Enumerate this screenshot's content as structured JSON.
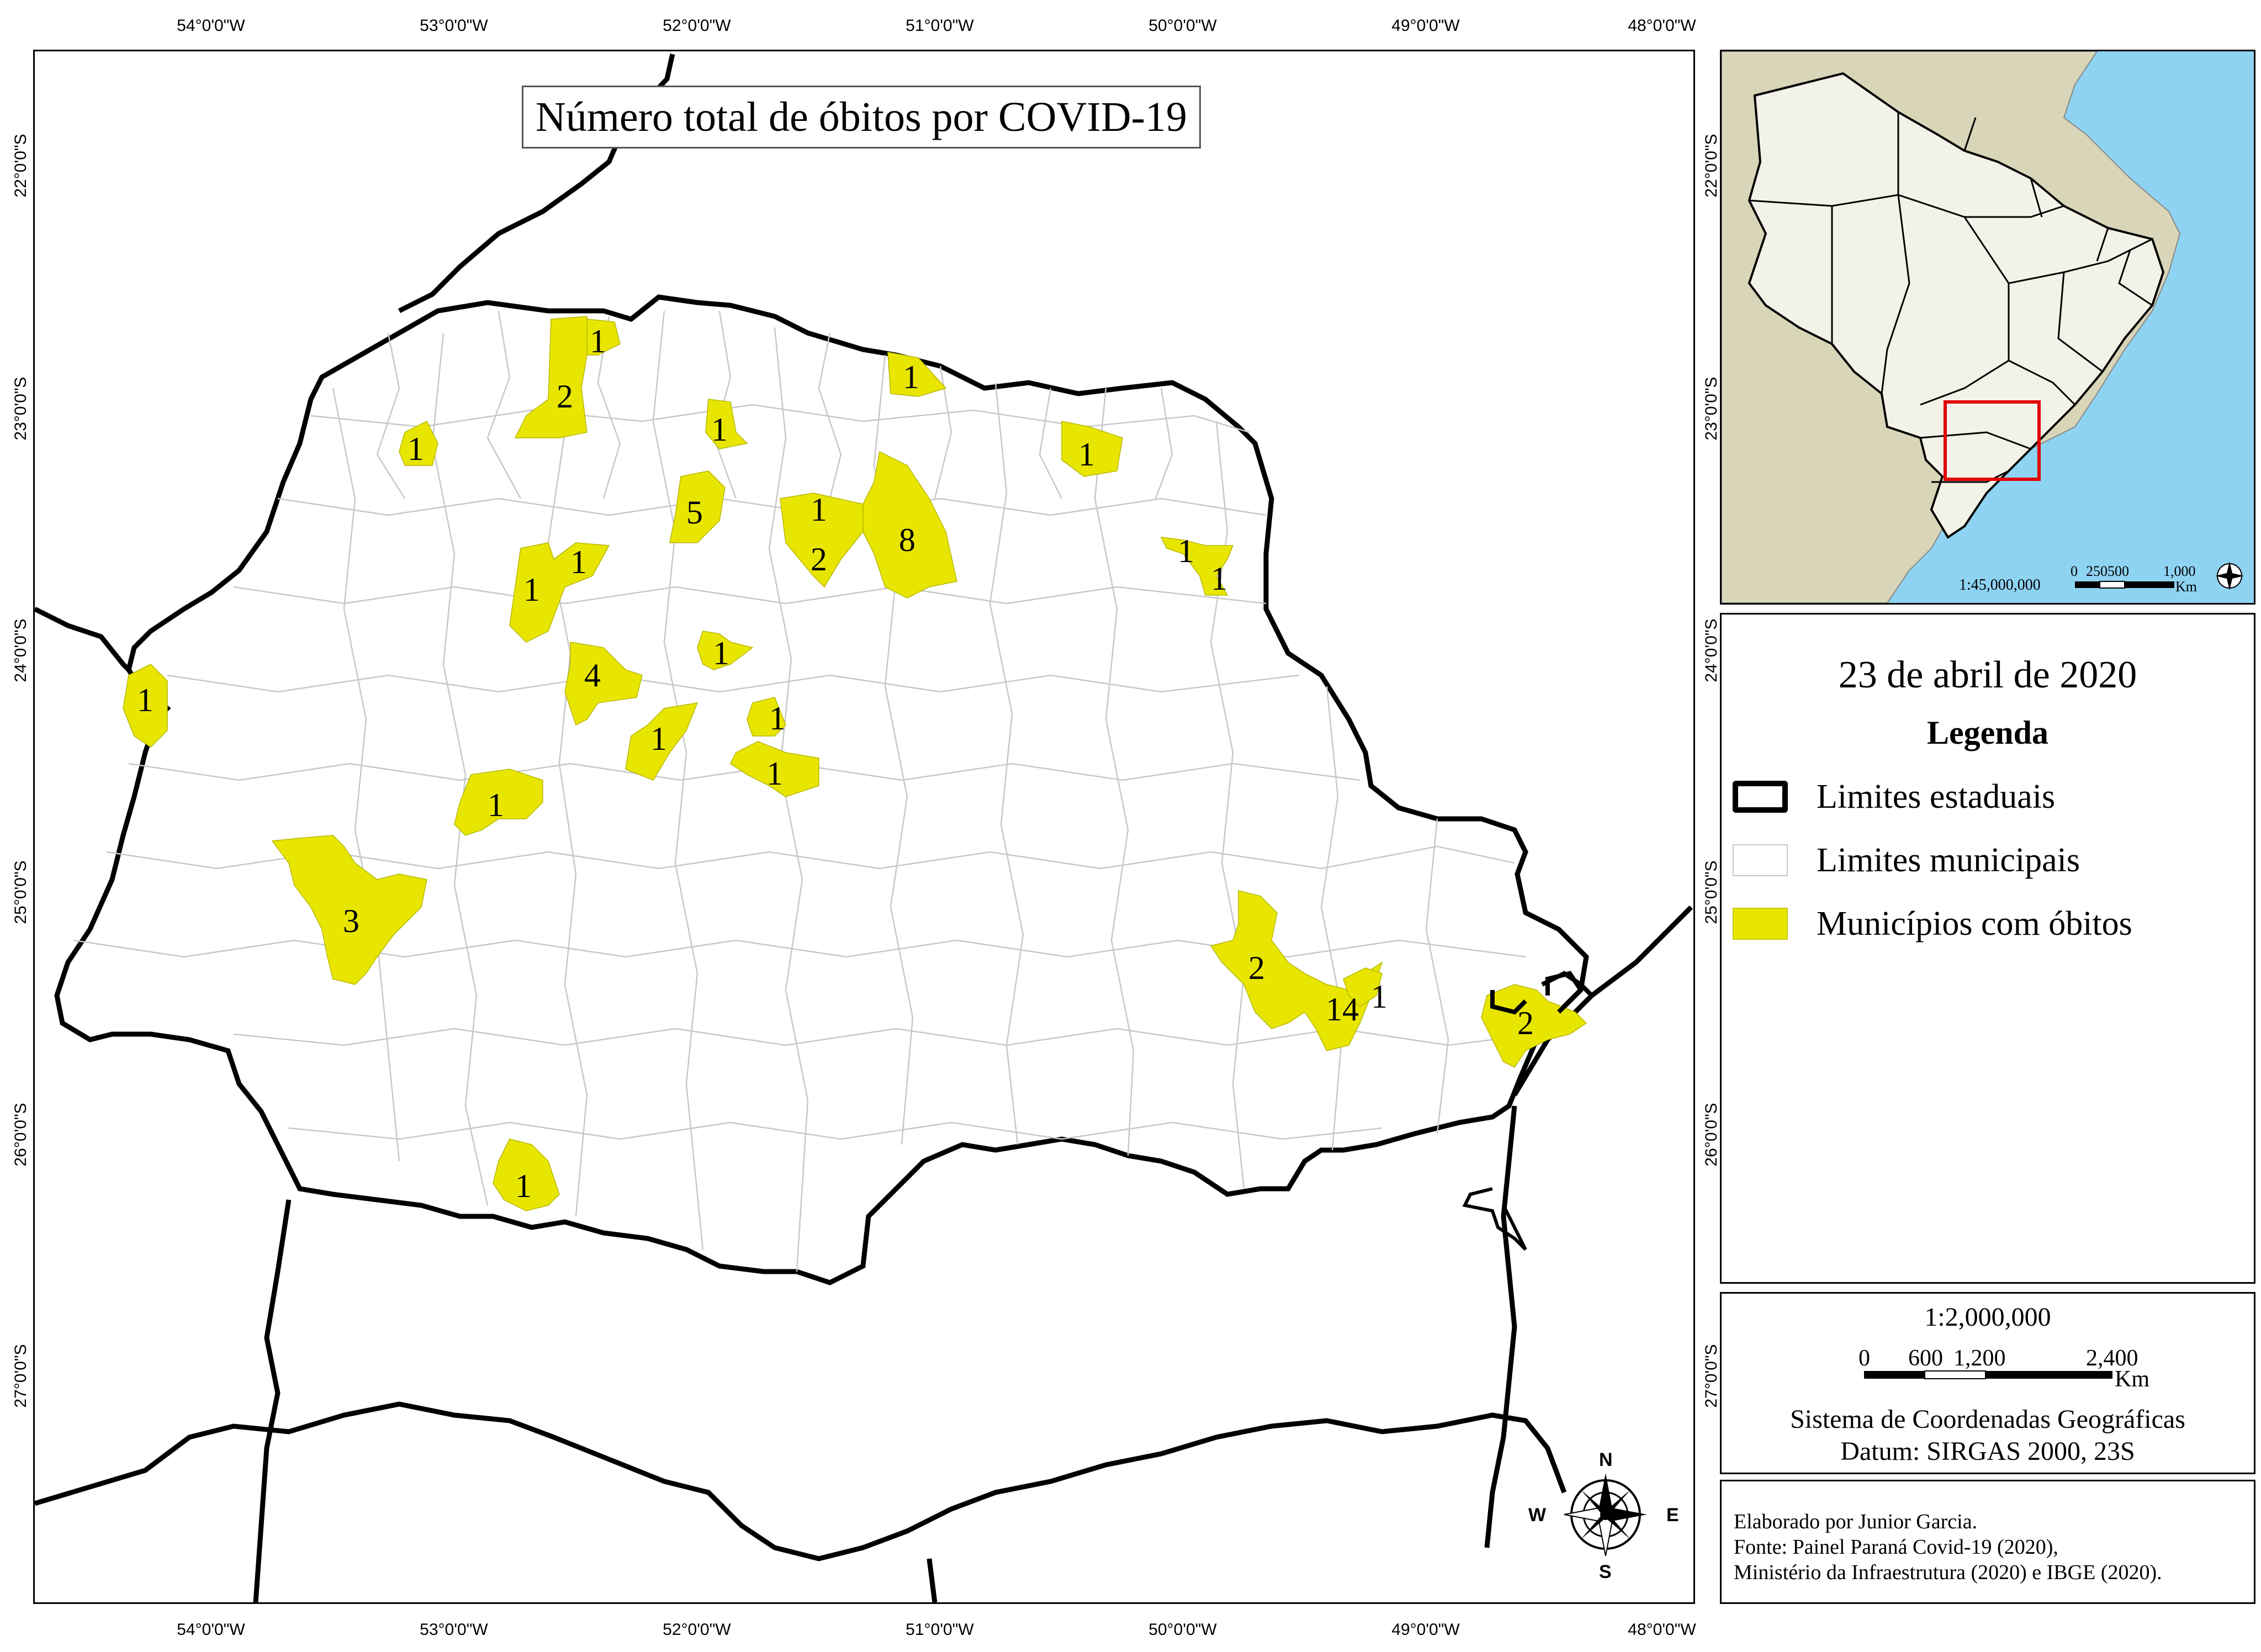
{
  "map": {
    "title": "Número total de óbitos por COVID-19",
    "lon_ticks": [
      "54°0'0\"W",
      "53°0'0\"W",
      "52°0'0\"W",
      "51°0'0\"W",
      "50°0'0\"W",
      "49°0'0\"W",
      "48°0'0\"W"
    ],
    "lat_ticks": [
      "22°0'0\"S",
      "23°0'0\"S",
      "24°0'0\"S",
      "25°0'0\"S",
      "26°0'0\"S",
      "27°0'0\"S"
    ],
    "colors": {
      "deaths_fill": "#e8e600",
      "state_border": "#000000",
      "municipal_border": "#c8c8c8",
      "ocean": "#8fd3f2",
      "land": "#d8d5b8"
    },
    "municipalities": [
      {
        "label": "1"
      },
      {
        "label": "2"
      },
      {
        "label": "1"
      },
      {
        "label": "1"
      },
      {
        "label": "1"
      },
      {
        "label": "1"
      },
      {
        "label": "5"
      },
      {
        "label": "1"
      },
      {
        "label": "8"
      },
      {
        "label": "2"
      },
      {
        "label": "1"
      },
      {
        "label": "1"
      },
      {
        "label": "1"
      },
      {
        "label": "1"
      },
      {
        "label": "4"
      },
      {
        "label": "1"
      },
      {
        "label": "1"
      },
      {
        "label": "1"
      },
      {
        "label": "1"
      },
      {
        "label": "1"
      },
      {
        "label": "1"
      },
      {
        "label": "3"
      },
      {
        "label": "2"
      },
      {
        "label": "14"
      },
      {
        "label": "1"
      },
      {
        "label": "2"
      },
      {
        "label": "1"
      }
    ],
    "compass": {
      "n": "N",
      "s": "S",
      "e": "E",
      "w": "W"
    }
  },
  "inset": {
    "scale_label": "1:45,000,000",
    "scale_ticks": [
      "0",
      "250500",
      "1,000"
    ],
    "scale_unit": "Km",
    "lat_ticks": [
      "22°0'0\"S",
      "23°0'0\"S"
    ],
    "highlight_color": "#e00000"
  },
  "legend": {
    "date": "23 de abril de 2020",
    "heading": "Legenda",
    "items": [
      {
        "label": "Limites estaduais",
        "swatch": "state"
      },
      {
        "label": "Limites municipais",
        "swatch": "municipal"
      },
      {
        "label": "Municípios com óbitos",
        "swatch": "deaths"
      }
    ]
  },
  "scale": {
    "ratio": "1:2,000,000",
    "ticks": [
      "0",
      "600",
      "1,200",
      "2,400"
    ],
    "unit": "Km",
    "crs": "Sistema de Coordenadas Geográficas",
    "datum": "Datum: SIRGAS 2000, 23S"
  },
  "credits": {
    "line1": "Elaborado por Junior Garcia.",
    "line2": "Fonte: Painel Paraná Covid-19 (2020),",
    "line3": "Ministério da Infraestrutura (2020) e IBGE (2020)."
  },
  "right_lat_ticks": [
    "22°0'0\"S",
    "23°0'0\"S",
    "24°0'0\"S",
    "25°0'0\"S",
    "26°0'0\"S",
    "27°0'0\"S"
  ]
}
